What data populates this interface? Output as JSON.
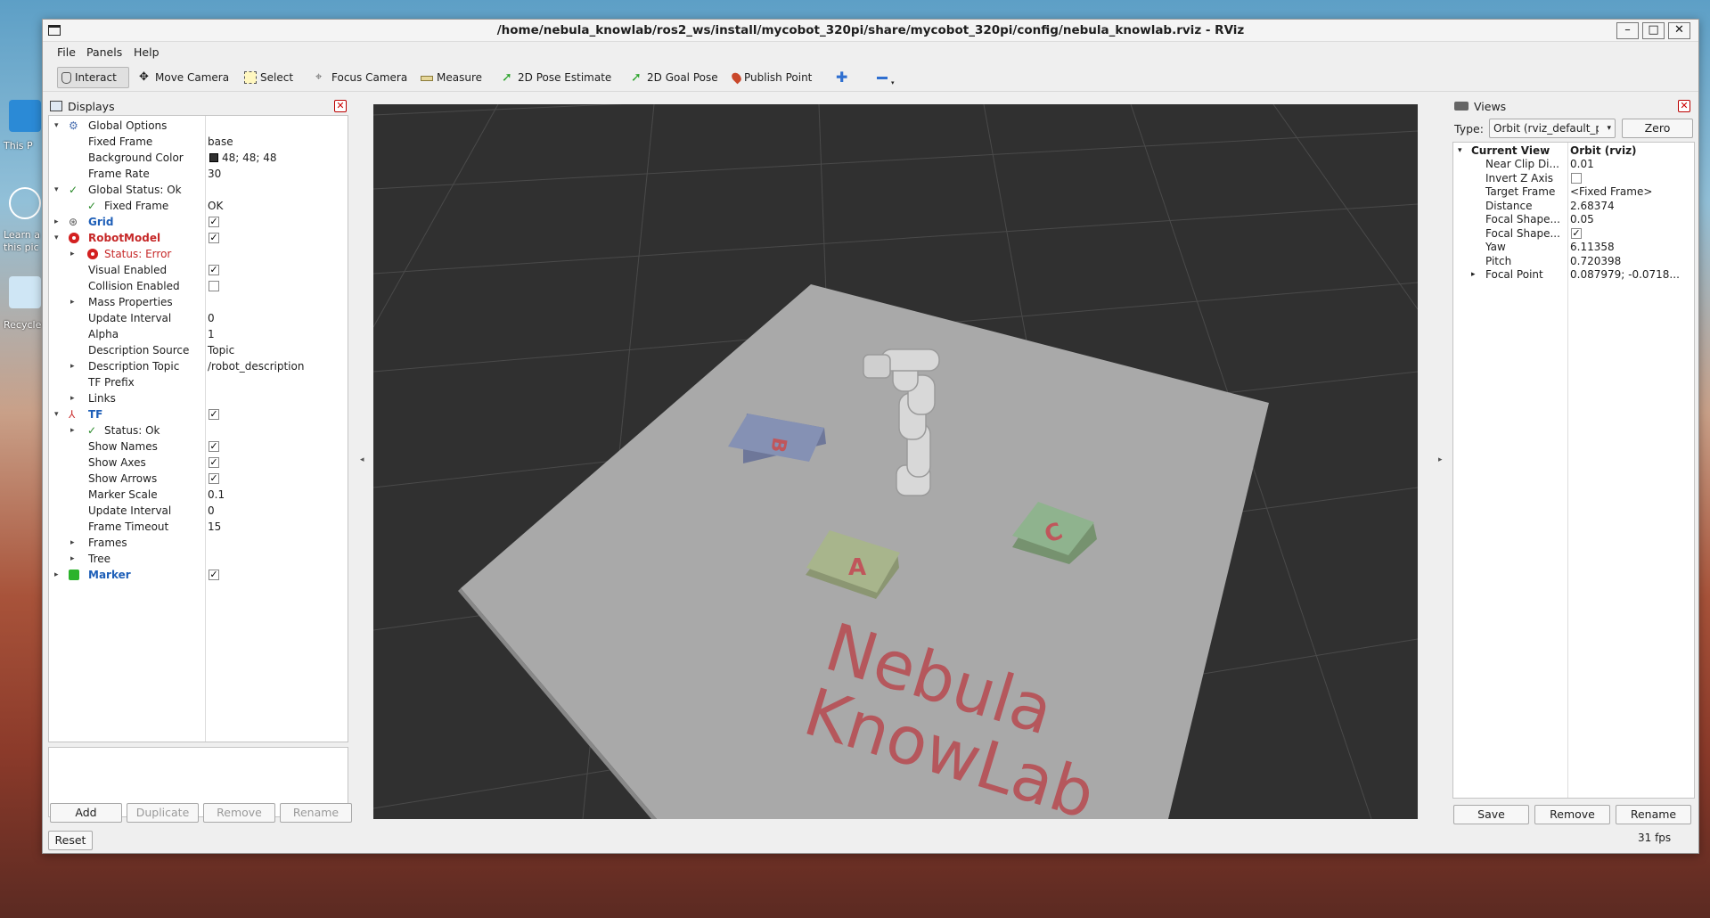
{
  "desktop": {
    "labels": [
      "This P",
      "Learn a",
      "this pic",
      "Recycle"
    ]
  },
  "window": {
    "title": "/home/nebula_knowlab/ros2_ws/install/mycobot_320pi/share/mycobot_320pi/config/nebula_knowlab.rviz - RViz",
    "buttons": {
      "minimize": "–",
      "maximize": "□",
      "close": "✕"
    }
  },
  "menu": [
    "File",
    "Panels",
    "Help"
  ],
  "toolbar": {
    "interact": "Interact",
    "move_camera": "Move Camera",
    "select": "Select",
    "focus_camera": "Focus Camera",
    "measure": "Measure",
    "pose_estimate": "2D Pose Estimate",
    "goal_pose": "2D Goal Pose",
    "publish_point": "Publish Point"
  },
  "displays": {
    "title": "Displays",
    "rows": [
      {
        "name": "Global Options",
        "value": "",
        "depth": 0,
        "arrow": "▾",
        "icon": "gear-icon",
        "style": ""
      },
      {
        "name": "Fixed Frame",
        "value": "base",
        "depth": 1,
        "style": ""
      },
      {
        "name": "Background Color",
        "value": "48; 48; 48",
        "depth": 1,
        "style": "",
        "swatch": "#303030"
      },
      {
        "name": "Frame Rate",
        "value": "30",
        "depth": 1,
        "style": ""
      },
      {
        "name": "Global Status: Ok",
        "value": "",
        "depth": 0,
        "arrow": "▾",
        "icon": "check-icon",
        "style": ""
      },
      {
        "name": "Fixed Frame",
        "value": "OK",
        "depth": 1,
        "icon": "check-icon",
        "style": ""
      },
      {
        "name": "Grid",
        "value": "",
        "depth": 0,
        "arrow": "▸",
        "icon": "grid-icon",
        "style": "blue",
        "check": "✓"
      },
      {
        "name": "RobotModel",
        "value": "",
        "depth": 0,
        "arrow": "▾",
        "icon": "error-icon",
        "style": "redb",
        "check": "✓"
      },
      {
        "name": "Status: Error",
        "value": "",
        "depth": 1,
        "arrow": "▸",
        "icon": "error-icon",
        "style": "red"
      },
      {
        "name": "Visual Enabled",
        "value": "",
        "depth": 1,
        "style": "",
        "check": "✓"
      },
      {
        "name": "Collision Enabled",
        "value": "",
        "depth": 1,
        "style": "",
        "check": " "
      },
      {
        "name": "Mass Properties",
        "value": "",
        "depth": 1,
        "arrow": "▸",
        "style": ""
      },
      {
        "name": "Update Interval",
        "value": "0",
        "depth": 1,
        "style": ""
      },
      {
        "name": "Alpha",
        "value": "1",
        "depth": 1,
        "style": ""
      },
      {
        "name": "Description Source",
        "value": "Topic",
        "depth": 1,
        "style": ""
      },
      {
        "name": "Description Topic",
        "value": "/robot_description",
        "depth": 1,
        "arrow": "▸",
        "style": ""
      },
      {
        "name": "TF Prefix",
        "value": "",
        "depth": 1,
        "style": ""
      },
      {
        "name": "Links",
        "value": "",
        "depth": 1,
        "arrow": "▸",
        "style": ""
      },
      {
        "name": "TF",
        "value": "",
        "depth": 0,
        "arrow": "▾",
        "icon": "axes-icon",
        "style": "blue",
        "check": "✓"
      },
      {
        "name": "Status: Ok",
        "value": "",
        "depth": 1,
        "arrow": "▸",
        "icon": "check-icon",
        "style": ""
      },
      {
        "name": "Show Names",
        "value": "",
        "depth": 1,
        "style": "",
        "check": "✓"
      },
      {
        "name": "Show Axes",
        "value": "",
        "depth": 1,
        "style": "",
        "check": "✓"
      },
      {
        "name": "Show Arrows",
        "value": "",
        "depth": 1,
        "style": "",
        "check": "✓"
      },
      {
        "name": "Marker Scale",
        "value": "0.1",
        "depth": 1,
        "style": ""
      },
      {
        "name": "Update Interval",
        "value": "0",
        "depth": 1,
        "style": ""
      },
      {
        "name": "Frame Timeout",
        "value": "15",
        "depth": 1,
        "style": ""
      },
      {
        "name": "Frames",
        "value": "",
        "depth": 1,
        "arrow": "▸",
        "style": ""
      },
      {
        "name": "Tree",
        "value": "",
        "depth": 1,
        "arrow": "▸",
        "style": ""
      },
      {
        "name": "Marker",
        "value": "",
        "depth": 0,
        "arrow": "▸",
        "icon": "marker-icon",
        "style": "blue",
        "check": "✓"
      }
    ],
    "buttons": {
      "add": "Add",
      "duplicate": "Duplicate",
      "remove": "Remove",
      "rename": "Rename",
      "reset": "Reset"
    }
  },
  "scene": {
    "background": "#303030",
    "plane_color": "#a9a9a9",
    "blocks": [
      {
        "label": "B",
        "color": "#8591b4"
      },
      {
        "label": "A",
        "color": "#a8b58c"
      },
      {
        "label": "C",
        "color": "#8fb38e"
      }
    ],
    "text_line1": "Nebula",
    "text_line2": "KnowLab",
    "text_color": "#b5575c"
  },
  "views": {
    "title": "Views",
    "type_label": "Type:",
    "type_value": "Orbit (rviz_default_plugins)",
    "zero": "Zero",
    "header_name": "Current View",
    "header_value": "Orbit (rviz)",
    "props": [
      {
        "name": "Near Clip Di...",
        "value": "0.01"
      },
      {
        "name": "Invert Z Axis",
        "value": "",
        "check": " "
      },
      {
        "name": "Target Frame",
        "value": "<Fixed Frame>"
      },
      {
        "name": "Distance",
        "value": "2.68374"
      },
      {
        "name": "Focal Shape...",
        "value": "0.05"
      },
      {
        "name": "Focal Shape...",
        "value": "",
        "check": "✓"
      },
      {
        "name": "Yaw",
        "value": "6.11358"
      },
      {
        "name": "Pitch",
        "value": "0.720398"
      },
      {
        "name": "Focal Point",
        "value": "0.087979; -0.0718...",
        "arrow": "▸"
      }
    ],
    "buttons": {
      "save": "Save",
      "remove": "Remove",
      "rename": "Rename"
    }
  },
  "status": {
    "fps": "31 fps"
  }
}
